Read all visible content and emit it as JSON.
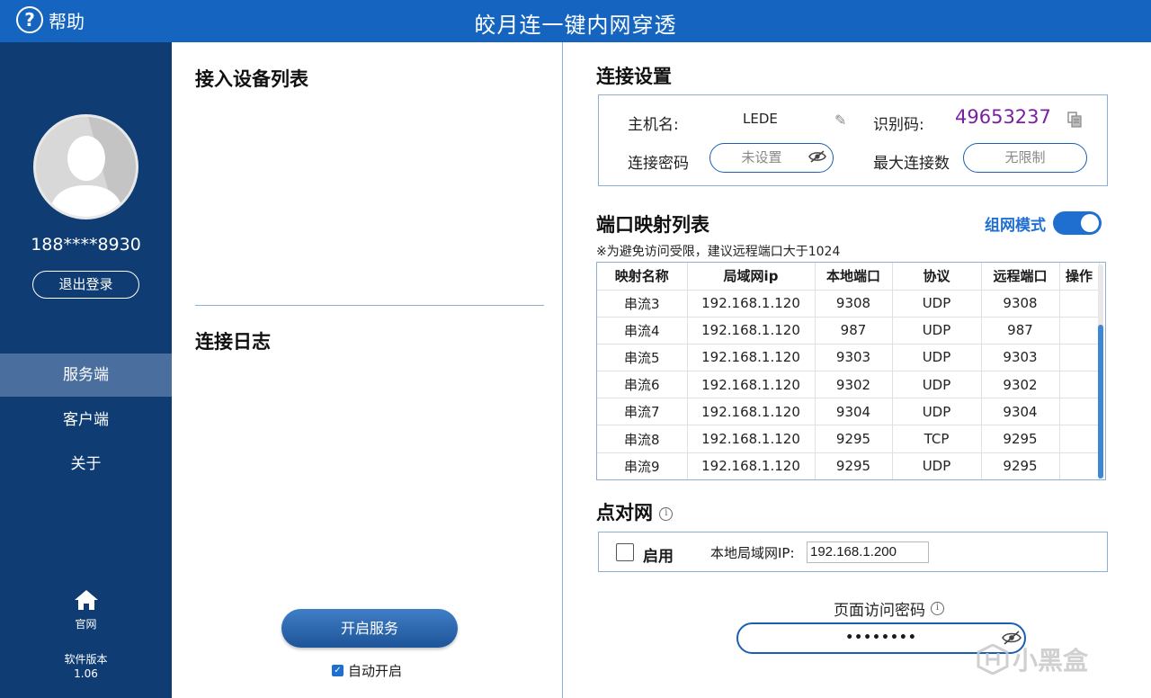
{
  "titlebar": {
    "help_label": "帮助",
    "app_title": "皎月连一键内网穿透",
    "help_icon": "question-circle-icon"
  },
  "sidebar": {
    "username": "188****8930",
    "logout_label": "退出登录",
    "nav": [
      {
        "label": "服务端",
        "active": true
      },
      {
        "label": "客户端",
        "active": false
      },
      {
        "label": "关于",
        "active": false
      }
    ],
    "site_label": "官网",
    "site_icon": "home-icon",
    "version_label": "软件版本",
    "version_value": "1.06",
    "bg_color": "#0f3c73"
  },
  "left": {
    "devices_title": "接入设备列表",
    "log_title": "连接日志",
    "start_button": "开启服务",
    "autostart_label": "自动开启",
    "autostart_checked": true
  },
  "settings": {
    "title": "连接设置",
    "hostname_label": "主机名:",
    "hostname_value": "LEDE",
    "id_label": "识别码:",
    "id_value": "49653237",
    "password_label": "连接密码",
    "password_value": "未设置",
    "max_conn_label": "最大连接数",
    "max_conn_value": "无限制"
  },
  "mapping": {
    "title": "端口映射列表",
    "mode_label": "组网模式",
    "mode_on": true,
    "note": "※为避免访问受限，建议远程端口大于1024",
    "columns": [
      "映射名称",
      "局域网ip",
      "本地端口",
      "协议",
      "远程端口",
      "操作"
    ],
    "rows": [
      [
        "串流3",
        "192.168.1.120",
        "9308",
        "UDP",
        "9308",
        ""
      ],
      [
        "串流4",
        "192.168.1.120",
        "987",
        "UDP",
        "987",
        ""
      ],
      [
        "串流5",
        "192.168.1.120",
        "9303",
        "UDP",
        "9303",
        ""
      ],
      [
        "串流6",
        "192.168.1.120",
        "9302",
        "UDP",
        "9302",
        ""
      ],
      [
        "串流7",
        "192.168.1.120",
        "9304",
        "UDP",
        "9304",
        ""
      ],
      [
        "串流8",
        "192.168.1.120",
        "9295",
        "TCP",
        "9295",
        ""
      ],
      [
        "串流9",
        "192.168.1.120",
        "9295",
        "UDP",
        "9295",
        ""
      ]
    ]
  },
  "p2p": {
    "title": "点对网",
    "info_icon": "info-icon",
    "enable_label": "启用",
    "enable_checked": false,
    "lan_ip_label": "本地局域网IP:",
    "lan_ip_value": "192.168.1.200"
  },
  "page_password": {
    "title": "页面访问密码",
    "value": "••••••••"
  },
  "watermark": {
    "text": "小黑盒"
  },
  "colors": {
    "titlebar": "#1565c0",
    "accent": "#1f6fd1",
    "id_code": "#7b1fa2"
  }
}
